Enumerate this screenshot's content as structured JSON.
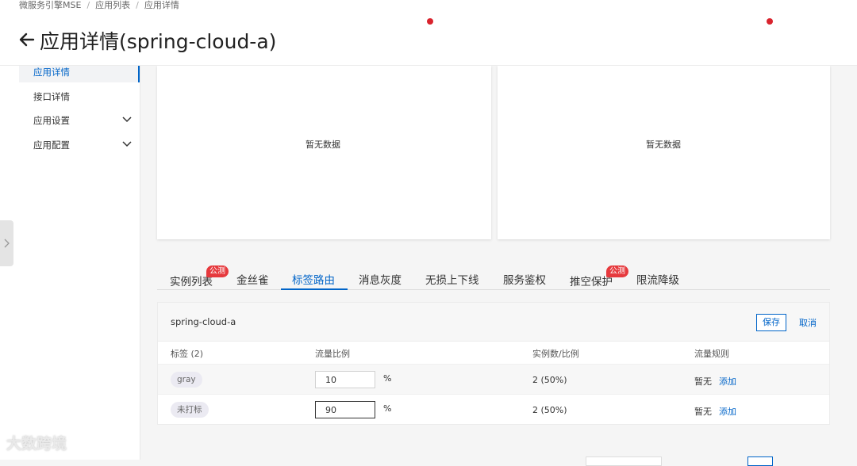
{
  "breadcrumb": [
    "微服务引擎MSE",
    "应用列表",
    "应用详情"
  ],
  "page_title": "应用详情(spring-cloud-a)",
  "sidebar": {
    "items": [
      {
        "label": "应用详情",
        "active": true,
        "expandable": false
      },
      {
        "label": "接口详情",
        "active": false,
        "expandable": false
      },
      {
        "label": "应用设置",
        "active": false,
        "expandable": true
      },
      {
        "label": "应用配置",
        "active": false,
        "expandable": true
      }
    ]
  },
  "cards": {
    "left_empty": "暂无数据",
    "right_empty": "暂无数据"
  },
  "tabs": [
    {
      "label": "实例列表",
      "badge": "公测",
      "active": false
    },
    {
      "label": "金丝雀",
      "active": false
    },
    {
      "label": "标签路由",
      "active": true
    },
    {
      "label": "消息灰度",
      "active": false
    },
    {
      "label": "无损上下线",
      "active": false
    },
    {
      "label": "服务鉴权",
      "active": false
    },
    {
      "label": "推空保护",
      "badge": "公测",
      "active": false
    },
    {
      "label": "限流降级",
      "active": false
    }
  ],
  "routing": {
    "app_name": "spring-cloud-a",
    "save_label": "保存",
    "cancel_label": "取消",
    "columns": [
      "标签 (2)",
      "流量比例",
      "实例数/比例",
      "流量规则"
    ],
    "percent_sign": "%",
    "rows": [
      {
        "tag": "gray",
        "ratio": "10",
        "instances": "2 (50%)",
        "rule": "暂无",
        "add": "添加"
      },
      {
        "tag": "未打标",
        "ratio": "90",
        "instances": "2 (50%)",
        "rule": "暂无",
        "add": "添加"
      }
    ]
  },
  "watermark": "大数跨境",
  "colors": {
    "accent": "#0064c8",
    "badge": "#e6393d",
    "dot": "#d9232d"
  }
}
